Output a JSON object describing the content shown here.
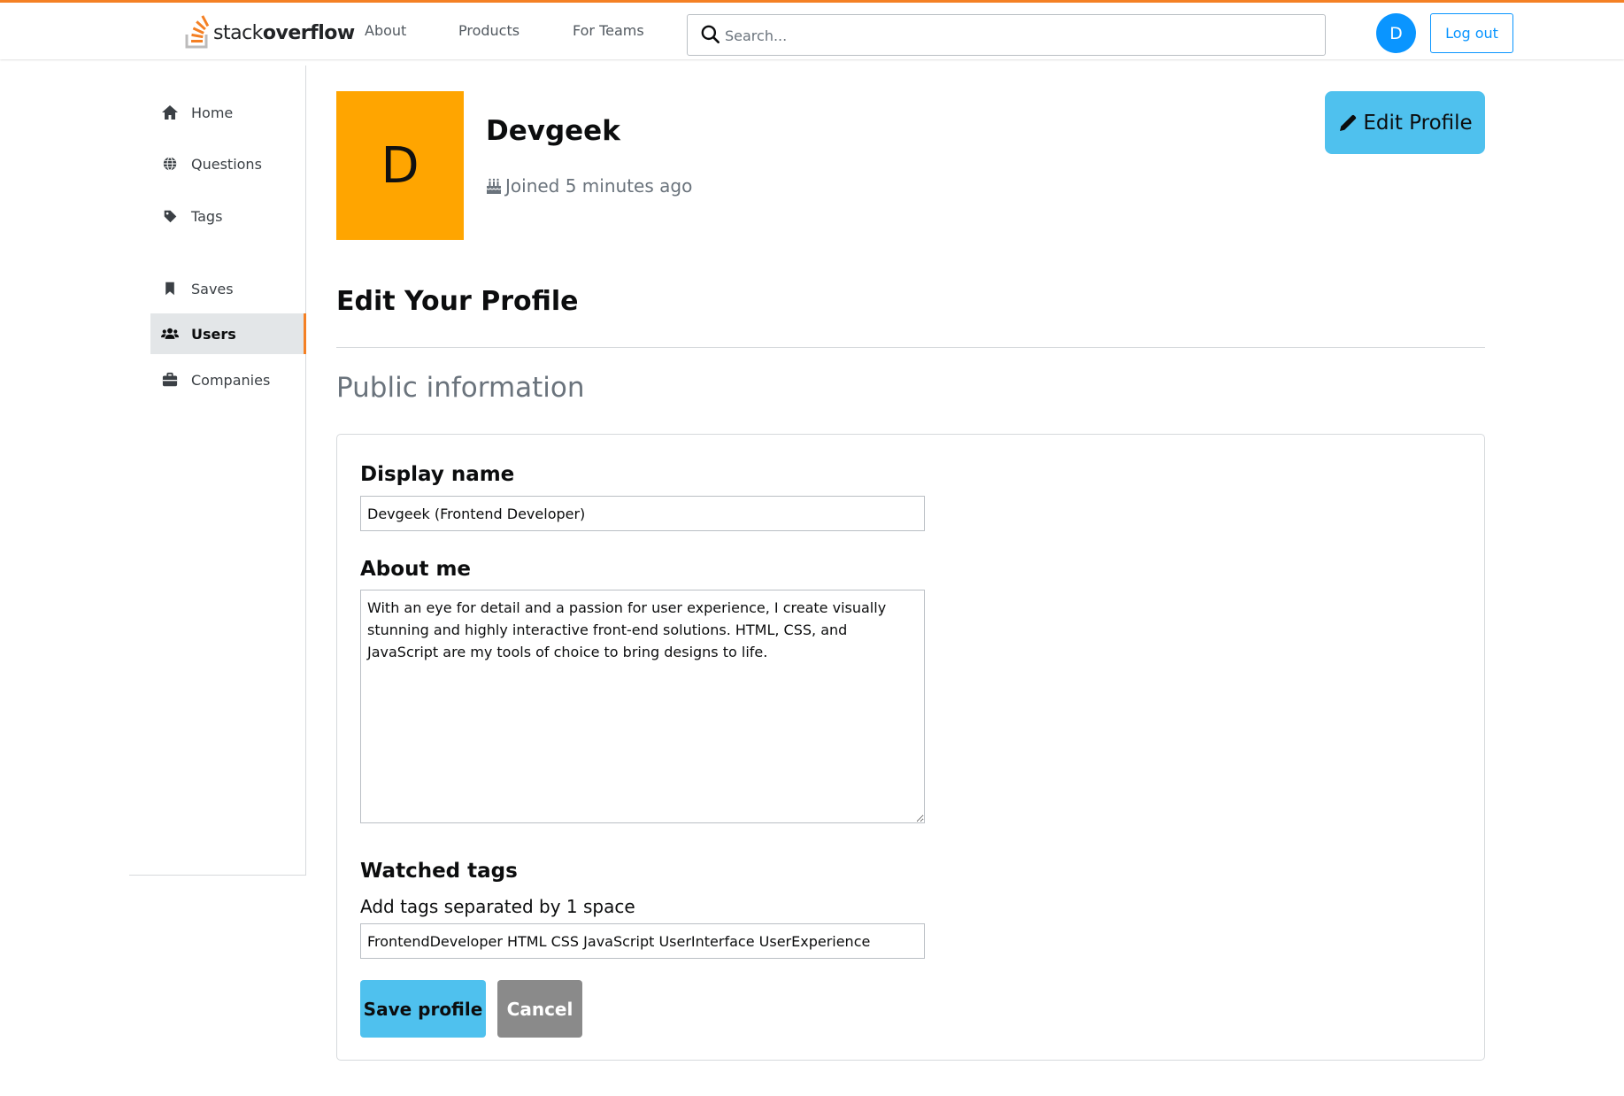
{
  "header": {
    "logo_text_light": "stack",
    "logo_text_bold": "overflow",
    "nav": [
      {
        "label": "About"
      },
      {
        "label": "Products"
      },
      {
        "label": "For Teams"
      }
    ],
    "search": {
      "placeholder": "Search...",
      "icon": "search-icon"
    },
    "avatar_initial": "D",
    "logout_label": "Log out",
    "accent_color": "#f48024"
  },
  "sidebar": {
    "items": [
      {
        "label": "Home",
        "icon": "home-icon"
      },
      {
        "label": "Questions",
        "icon": "globe-icon"
      },
      {
        "label": "Tags",
        "icon": "tag-icon"
      },
      {
        "label": "Saves",
        "icon": "bookmark-icon"
      },
      {
        "label": "Users",
        "icon": "users-icon",
        "active": true
      },
      {
        "label": "Companies",
        "icon": "briefcase-icon"
      }
    ]
  },
  "profile": {
    "avatar_initial": "D",
    "avatar_color": "#ffa500",
    "name": "Devgeek",
    "joined": "Joined 5 minutes ago",
    "edit_button": "Edit Profile"
  },
  "main": {
    "title": "Edit Your Profile",
    "subtitle": "Public information"
  },
  "form": {
    "display_name_label": "Display name",
    "display_name_value": "Devgeek (Frontend Developer)",
    "about_label": "About me",
    "about_value": "With an eye for detail and a passion for user experience, I create visually stunning and highly interactive front-end solutions. HTML, CSS, and JavaScript are my tools of choice to bring designs to life.",
    "tags_label": "Watched tags",
    "tags_hint": "Add tags separated by 1 space",
    "tags_value": "FrontendDeveloper HTML CSS JavaScript UserInterface UserExperience",
    "save_label": "Save profile",
    "cancel_label": "Cancel",
    "primary_color": "#4fc1ee"
  }
}
